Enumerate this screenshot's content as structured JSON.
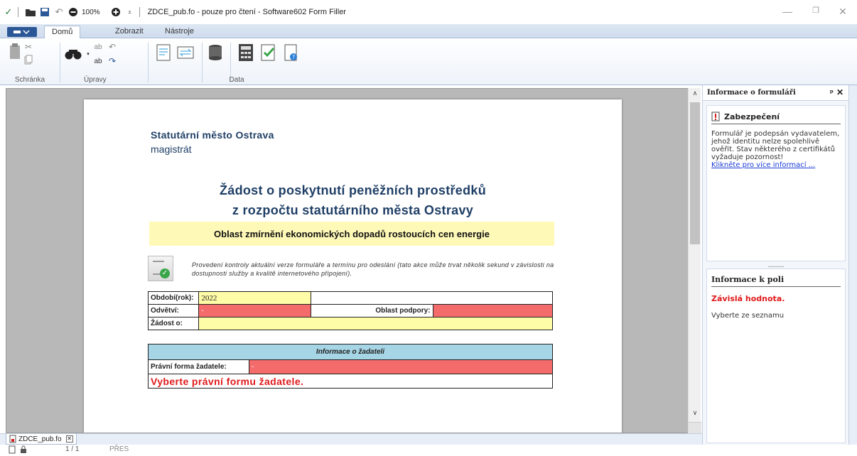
{
  "window": {
    "title": "ZDCE_pub.fo - pouze pro čtení - Software602 Form Filler",
    "zoom": "100%"
  },
  "ribbon": {
    "tabs": [
      "Domů",
      "Zobrazit",
      "Nástroje"
    ],
    "active_tab": "Domů",
    "groups": [
      "Schránka",
      "Úpravy",
      "Data"
    ]
  },
  "form": {
    "org_name": "Statutární město Ostrava",
    "org_sub": "magistrát",
    "title_line1": "Žádost o poskytnutí peněžních prostředků",
    "title_line2": "z rozpočtu statutárního města Ostravy",
    "subtitle": "Oblast zmírnění ekonomických dopadů rostoucích cen energie",
    "check_text": "Provedení kontroly aktuální verze formuláře a termínu pro odeslání (tato akce může trvat několik sekund v závislosti na dostupnosti služby a kvalitě internetového připojení).",
    "period_label": "Období(rok):",
    "period_value": "2022",
    "sector_label": "Odvětví:",
    "sector_value": "-",
    "support_label": "Oblast podpory:",
    "support_value": "",
    "request_label": "Žádost o:",
    "request_value": "",
    "applicant_header": "Informace o žadateli",
    "legal_form_label": "Právní forma žadatele:",
    "legal_form_value": "-",
    "error_text": "Vyberte právní formu žadatele."
  },
  "panel": {
    "title": "Informace o formuláři",
    "security_title": "Zabezpečení",
    "security_text": "Formulář je podepsán vydavatelem, jehož identitu nelze spolehlivě ověřit. Stav některého z certifikátů vyžaduje pozornost!",
    "security_link": "Klikněte pro více informací ...",
    "dots": "........",
    "field_title": "Informace k poli",
    "field_status": "Závislá hodnota.",
    "field_hint": "Vyberte ze seznamu"
  },
  "doc_tab": {
    "label": "ZDCE_pub.fo"
  },
  "status": {
    "pages": "1 / 1",
    "mode": "PŘES"
  },
  "colors": {
    "ribbon_blue": "#2b5797",
    "required_red": "#f46b6b",
    "input_yellow": "#fffca8",
    "header_cyan": "#a6d5e5",
    "error_red": "#e0191b"
  }
}
